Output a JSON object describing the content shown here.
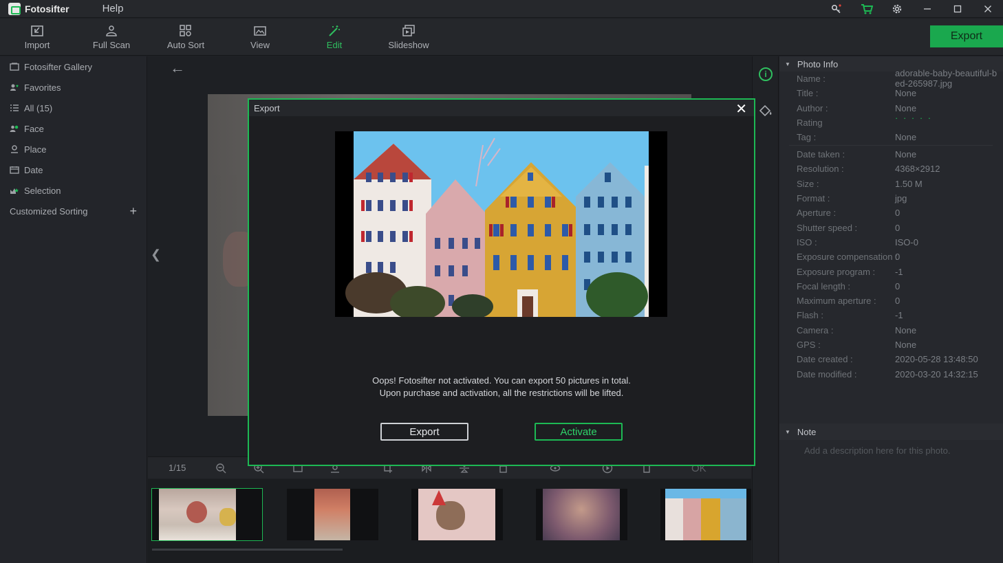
{
  "app": {
    "name": "Fotosifter",
    "menu_help": "Help"
  },
  "toolbar": {
    "items": [
      {
        "label": "Import"
      },
      {
        "label": "Full Scan"
      },
      {
        "label": "Auto Sort"
      },
      {
        "label": "View"
      },
      {
        "label": "Edit"
      },
      {
        "label": "Slideshow"
      }
    ],
    "active": "Edit",
    "export_label": "Export"
  },
  "sidebar": {
    "items": [
      {
        "label": "Fotosifter Gallery"
      },
      {
        "label": "Favorites"
      },
      {
        "label": "All (15)"
      },
      {
        "label": "Face"
      },
      {
        "label": "Place"
      },
      {
        "label": "Date"
      },
      {
        "label": "Selection"
      }
    ],
    "custom_sorting": "Customized Sorting",
    "add_symbol": "+"
  },
  "viewer": {
    "counter": "1/15",
    "ok_label": "OK"
  },
  "photo_info": {
    "header": "Photo Info",
    "rows": [
      {
        "label": "Name :",
        "value": "adorable-baby-beautiful-bed-265987.jpg"
      },
      {
        "label": "Title :",
        "value": "None"
      },
      {
        "label": "Author :",
        "value": "None"
      },
      {
        "label": "Rating",
        "value": "· · · · ·"
      },
      {
        "label": "Tag :",
        "value": "None"
      },
      {
        "label": "Date taken :",
        "value": "None"
      },
      {
        "label": "Resolution :",
        "value": "4368×2912"
      },
      {
        "label": "Size :",
        "value": "1.50  M"
      },
      {
        "label": "Format :",
        "value": "jpg"
      },
      {
        "label": "Aperture :",
        "value": "0"
      },
      {
        "label": "Shutter speed :",
        "value": "0"
      },
      {
        "label": "ISO :",
        "value": "ISO-0"
      },
      {
        "label": "Exposure compensation :",
        "value": "0"
      },
      {
        "label": "Exposure program :",
        "value": "-1"
      },
      {
        "label": "Focal length :",
        "value": "0"
      },
      {
        "label": "Maximum aperture :",
        "value": "0"
      },
      {
        "label": "Flash :",
        "value": "-1"
      },
      {
        "label": "Camera :",
        "value": "None"
      },
      {
        "label": "GPS :",
        "value": "None"
      },
      {
        "label": "Date created :",
        "value": "2020-05-28 13:48:50"
      },
      {
        "label": "Date modified :",
        "value": "2020-03-20 14:32:15"
      }
    ]
  },
  "note": {
    "header": "Note",
    "placeholder": "Add a description here for this photo."
  },
  "dialog": {
    "title": "Export",
    "message_line1": "Oops! Fotosifter not activated. You can export 50 pictures in total.",
    "message_line2": "Upon purchase and activation, all the restrictions will be lifted.",
    "export_button": "Export",
    "activate_button": "Activate"
  },
  "colors": {
    "accent": "#1db954",
    "background": "#1f2125"
  }
}
